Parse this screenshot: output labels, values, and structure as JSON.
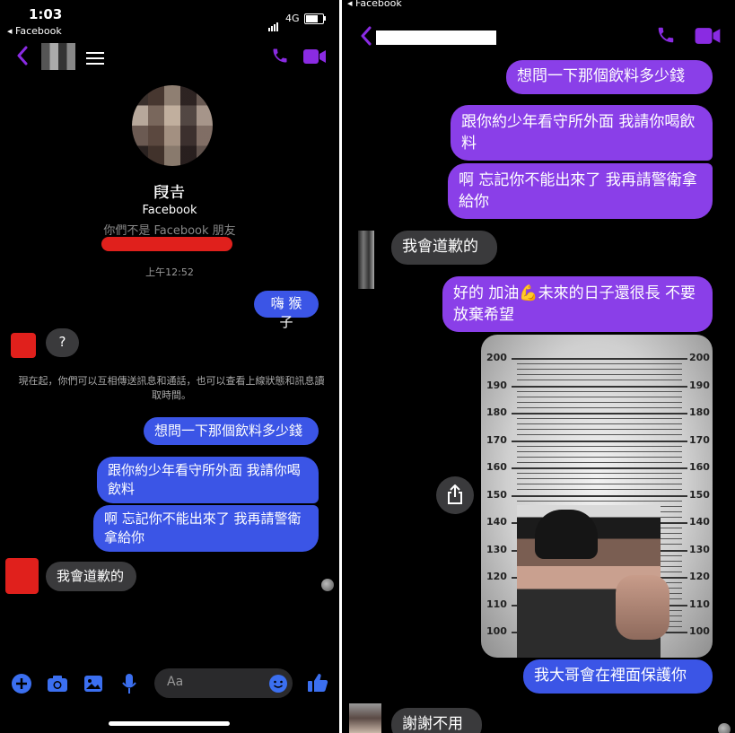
{
  "left": {
    "status": {
      "time": "1:03",
      "back_app": "◂ Facebook",
      "network": "4G"
    },
    "header": {
      "back_label": "‹"
    },
    "profile": {
      "name": "𠭊𠮷",
      "subtitle": "Facebook",
      "relation": "你們不是 Facebook 朋友"
    },
    "timestamp": "上午12:52",
    "messages": [
      {
        "dir": "out",
        "text": "嗨 猴子"
      },
      {
        "dir": "in",
        "text": "?"
      },
      {
        "dir": "notice",
        "text": "現在起，你們可以互相傳送訊息和通話，也可以查看上線狀態和訊息讀取時間。"
      },
      {
        "dir": "out",
        "text": "想問一下那個飲料多少錢"
      },
      {
        "dir": "out",
        "text": "跟你約少年看守所外面 我請你喝飲料"
      },
      {
        "dir": "out",
        "text": "啊 忘記你不能出來了 我再請警衛拿給你"
      },
      {
        "dir": "in",
        "text": "我會道歉的"
      }
    ],
    "composer": {
      "placeholder": "Aa"
    }
  },
  "right": {
    "status": {
      "back_app": "◂ Facebook"
    },
    "messages": [
      {
        "dir": "out",
        "text": "想問一下那個飲料多少錢"
      },
      {
        "dir": "out",
        "text": "跟你約少年看守所外面 我請你喝飲料"
      },
      {
        "dir": "out",
        "text": "啊 忘記你不能出來了 我再請警衛拿給你"
      },
      {
        "dir": "in",
        "text": "我會道歉的"
      },
      {
        "dir": "out",
        "text": "好的 加油💪未來的日子還很長 不要放棄希望"
      },
      {
        "dir": "out",
        "text": "我大哥會在裡面保護你"
      },
      {
        "dir": "in",
        "text": "謝謝不用"
      }
    ],
    "height_chart": {
      "labels": [
        "200",
        "190",
        "180",
        "170",
        "160",
        "150",
        "140",
        "130",
        "120",
        "110",
        "100"
      ]
    }
  },
  "colors": {
    "accent": "#8a2be2",
    "bubble_left": "#3b55e6",
    "bubble_right": "#8a3fe8",
    "incoming": "#3a3a3c"
  },
  "icons": [
    "chevron-left-icon",
    "menu-icon",
    "phone-icon",
    "video-icon",
    "plus-icon",
    "camera-icon",
    "image-icon",
    "mic-icon",
    "emoji-icon",
    "like-icon",
    "share-icon"
  ]
}
